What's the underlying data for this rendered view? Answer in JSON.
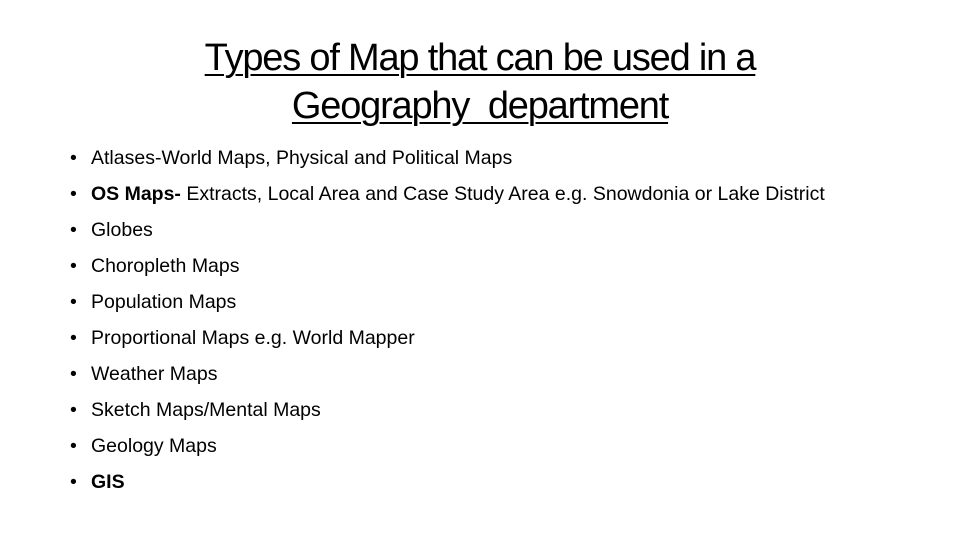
{
  "slide": {
    "title_line1": "Types of Map that can be used in a",
    "title_line2": "Geography  department",
    "bullet_char": "•",
    "items": [
      {
        "bold": "",
        "text": "Atlases-World Maps, Physical and Political Maps"
      },
      {
        "bold": "OS Maps-",
        "text": " Extracts, Local Area and Case Study Area e.g. Snowdonia or Lake District"
      },
      {
        "bold": "",
        "text": "Globes"
      },
      {
        "bold": "",
        "text": "Choropleth Maps"
      },
      {
        "bold": "",
        "text": "Population Maps"
      },
      {
        "bold": "",
        "text": "Proportional Maps e.g. World Mapper"
      },
      {
        "bold": "",
        "text": "Weather Maps"
      },
      {
        "bold": "",
        "text": "Sketch Maps/Mental Maps"
      },
      {
        "bold": "",
        "text": "Geology Maps"
      },
      {
        "bold": "GIS",
        "text": ""
      }
    ]
  }
}
